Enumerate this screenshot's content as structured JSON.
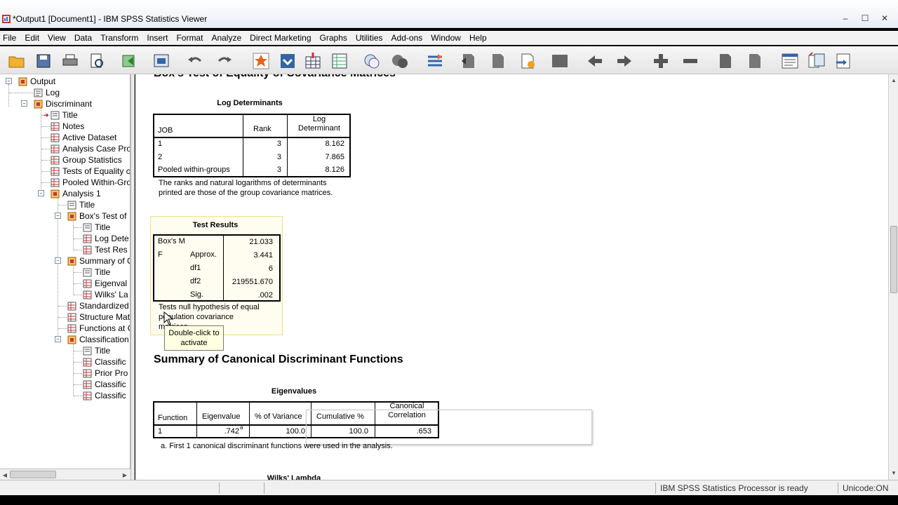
{
  "window": {
    "title": "*Output1 [Document1] - IBM SPSS Statistics Viewer",
    "controls": [
      "–",
      "☐",
      "✕"
    ]
  },
  "menubar": [
    "File",
    "Edit",
    "View",
    "Data",
    "Transform",
    "Insert",
    "Format",
    "Analyze",
    "Direct Marketing",
    "Graphs",
    "Utilities",
    "Add-ons",
    "Window",
    "Help"
  ],
  "toolbar_icons": [
    "open-folder-icon",
    "save-icon",
    "print-icon",
    "print-preview-icon",
    "export-icon",
    "recall-dialog-icon",
    "undo-icon",
    "redo-icon",
    "goto-data-icon",
    "goto-case-icon",
    "goto-variable-icon",
    "variables-icon",
    "designate-window-icon",
    "select-cases-icon",
    "show-all-icon",
    "promote-icon",
    "demote-icon",
    "insert-title-icon",
    "insert-heading-icon",
    "previous-icon",
    "next-icon",
    "expand-icon",
    "collapse-icon",
    "show-icon",
    "hide-icon",
    "insert-output-icon",
    "insert-text-icon",
    "insert-chart-icon"
  ],
  "tree": {
    "root": "Output",
    "log": "Log",
    "discriminant": "Discriminant",
    "disc_children": [
      "Title",
      "Notes",
      "Active Dataset",
      "Analysis Case Pro",
      "Group Statistics",
      "Tests of Equality c",
      "Pooled Within-Gro"
    ],
    "analysis1": "Analysis 1",
    "a1_title": "Title",
    "box": "Box's Test of",
    "box_children": [
      "Title",
      "Log Dete",
      "Test Res"
    ],
    "summary": "Summary of C",
    "summary_children": [
      "Title",
      "Eigenval",
      "Wilks' La"
    ],
    "a1_items": [
      "Standardized",
      "Structure Matr",
      "Functions at G"
    ],
    "classification": "Classification",
    "class_children": [
      "Title",
      "Classific",
      "Prior Pro",
      "Classific",
      "Classific"
    ]
  },
  "output": {
    "box_heading": "Box's Test of Equality of Covariance Matrices",
    "log_det": {
      "caption": "Log Determinants",
      "headers": [
        "JOB",
        "Rank",
        "Log Determinant"
      ],
      "rows": [
        [
          "1",
          "3",
          "8.162"
        ],
        [
          "2",
          "3",
          "7.865"
        ],
        [
          "Pooled within-groups",
          "3",
          "8.126"
        ]
      ],
      "note_line1": "The ranks and natural logarithms of determinants",
      "note_line2": "printed are those of the group covariance matrices."
    },
    "test_results": {
      "caption": "Test Results",
      "rows": [
        {
          "label": "Box's M",
          "sub": "",
          "value": "21.033"
        },
        {
          "label": "F",
          "sub": "Approx.",
          "value": "3.441"
        },
        {
          "label": "",
          "sub": "df1",
          "value": "6"
        },
        {
          "label": "",
          "sub": "df2",
          "value": "219551.670"
        },
        {
          "label": "",
          "sub": "Sig.",
          "value": ".002"
        }
      ],
      "note_line1": "Tests null hypothesis of equal",
      "note_line2": "population covariance",
      "note_line3": "matrices."
    },
    "tooltip_line1": "Double-click to",
    "tooltip_line2": "activate",
    "summary_heading": "Summary of Canonical Discriminant Functions",
    "eigen": {
      "caption": "Eigenvalues",
      "headers": [
        "Function",
        "Eigenvalue",
        "% of Variance",
        "Cumulative %",
        "Canonical Correlation"
      ],
      "row": [
        "1",
        ".742",
        "a",
        "100.0",
        "100.0",
        ".653"
      ],
      "footnote": "a. First 1 canonical discriminant functions were used in the analysis."
    },
    "wilks_caption": "Wilks' Lambda"
  },
  "status": {
    "processor": "IBM SPSS Statistics Processor is ready",
    "unicode": "Unicode:ON"
  }
}
